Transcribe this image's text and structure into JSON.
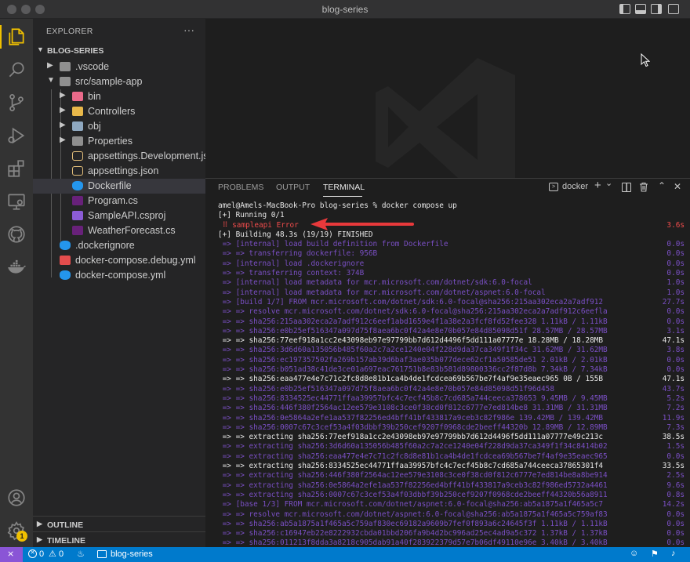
{
  "window": {
    "title": "blog-series"
  },
  "explorer": {
    "header": "EXPLORER",
    "more": "···",
    "folder": "BLOG-SERIES",
    "tree": [
      {
        "name": ".vscode",
        "type": "folder"
      },
      {
        "name": "src/sample-app",
        "type": "folder"
      },
      {
        "name": "bin",
        "type": "folder"
      },
      {
        "name": "Controllers",
        "type": "folder"
      },
      {
        "name": "obj",
        "type": "folder"
      },
      {
        "name": "Properties",
        "type": "folder"
      },
      {
        "name": "appsettings.Development.json",
        "type": "json"
      },
      {
        "name": "appsettings.json",
        "type": "json"
      },
      {
        "name": "Dockerfile",
        "type": "docker"
      },
      {
        "name": "Program.cs",
        "type": "csharp"
      },
      {
        "name": "SampleAPI.csproj",
        "type": "csproj"
      },
      {
        "name": "WeatherForecast.cs",
        "type": "csharp"
      },
      {
        "name": ".dockerignore",
        "type": "docker"
      },
      {
        "name": "docker-compose.debug.yml",
        "type": "yml"
      },
      {
        "name": "docker-compose.yml",
        "type": "docker"
      }
    ],
    "outline": "OUTLINE",
    "timeline": "TIMELINE"
  },
  "activity_icons": [
    "files-icon",
    "search-icon",
    "source-control-icon",
    "run-debug-icon",
    "extensions-icon",
    "remote-explorer-icon",
    "github-icon",
    "docker-icon",
    "account-icon",
    "settings-gear-icon"
  ],
  "account_badge": "1",
  "panel": {
    "tabs": {
      "problems": "PROBLEMS",
      "output": "OUTPUT",
      "terminal": "TERMINAL"
    },
    "terminal_name": "docker",
    "add": "+",
    "dropdown": "⌄",
    "lines": [
      {
        "t": "amel@Amels-MacBook-Pro blog-series % docker compose up",
        "tm": "",
        "c": "#e8e8e8"
      },
      {
        "t": "[+] Running 0/1",
        "tm": "",
        "c": "#e8e8e8"
      },
      {
        "t": " ⠿ sampleapi Error",
        "tm": "3.6s",
        "c": "#f14c4c"
      },
      {
        "t": "[+] Building 48.3s (19/19) FINISHED",
        "tm": "",
        "c": "#e8e8e8"
      },
      {
        "t": " => [internal] load build definition from Dockerfile",
        "tm": "0.0s",
        "c": "#7a4fc4"
      },
      {
        "t": " => => transferring dockerfile: 956B",
        "tm": "0.0s",
        "c": "#7a4fc4"
      },
      {
        "t": " => [internal] load .dockerignore",
        "tm": "0.0s",
        "c": "#7a4fc4"
      },
      {
        "t": " => => transferring context: 374B",
        "tm": "0.0s",
        "c": "#7a4fc4"
      },
      {
        "t": " => [internal] load metadata for mcr.microsoft.com/dotnet/sdk:6.0-focal",
        "tm": "1.0s",
        "c": "#7a4fc4"
      },
      {
        "t": " => [internal] load metadata for mcr.microsoft.com/dotnet/aspnet:6.0-focal",
        "tm": "1.0s",
        "c": "#7a4fc4"
      },
      {
        "t": " => [build 1/7] FROM mcr.microsoft.com/dotnet/sdk:6.0-focal@sha256:215aa302eca2a7adf912",
        "tm": "27.7s",
        "c": "#7a4fc4"
      },
      {
        "t": " => => resolve mcr.microsoft.com/dotnet/sdk:6.0-focal@sha256:215aa302eca2a7adf912c6eefla",
        "tm": "0.0s",
        "c": "#7a4fc4"
      },
      {
        "t": " => => sha256:215aa302eca2a7adf912c6eef1abd1659e4f1a38e2a3fcf8fd52fee328 1.11kB / 1.11kB",
        "tm": "0.0s",
        "c": "#7a4fc4"
      },
      {
        "t": " => => sha256:e0b25ef516347a097d75f8aea6bc0f42a4e8e70b057e84d85098d51f 28.57MB / 28.57MB",
        "tm": "3.1s",
        "c": "#7a4fc4"
      },
      {
        "t": " => => sha256:77eef918a1cc2e43098eb97e97799bb7d612d4496f5dd111a07777e 18.28MB / 18.28MB",
        "tm": "47.1s",
        "c": "#e8e8e8"
      },
      {
        "t": " => => sha256:3d6d60a135056b485f60a2c7a2ce1240e04f228d9da37ca349f1f34c 31.62MB / 31.62MB",
        "tm": "3.8s",
        "c": "#7a4fc4"
      },
      {
        "t": " => => sha256:ec197357502fa269b157ab39d6baf3ae035b077dece62cf1a50585de51 2.01kB / 2.01kB",
        "tm": "0.0s",
        "c": "#7a4fc4"
      },
      {
        "t": " => => sha256:b051ad38c41de3ce01a697eac761751b8e83b581d89800336cc2f87d8b 7.34kB / 7.34kB",
        "tm": "0.0s",
        "c": "#7a4fc4"
      },
      {
        "t": " => => sha256:eaa477e4e7c71c2fc8d8e81b1ca4b4de1fcdcea69b567be7f4af9e35eaec965 0B / 155B",
        "tm": "47.1s",
        "c": "#e8e8e8"
      },
      {
        "t": " => => sha256:e0b25ef516347a097d75f8aea6bc0f42a4e8e70b057e84d85098d51f96d458",
        "tm": "43.7s",
        "c": "#7a4fc4"
      },
      {
        "t": " => => sha256:8334525ec44771ffaa39957bfc4c7ecf45b8c7cd685a744ceeca378653 9.45MB / 9.45MB",
        "tm": "5.2s",
        "c": "#7a4fc4"
      },
      {
        "t": " => => sha256:446f380f2564ac12ee579e3108c3ce0f38cd0f812c6777e7ed814be8 31.31MB / 31.31MB",
        "tm": "7.2s",
        "c": "#7a4fc4"
      },
      {
        "t": " => => sha256:0e5864a2efe1aa537f82256ed4bff41bf433817a9ceb3c82f986e 139.42MB / 139.42MB",
        "tm": "11.9s",
        "c": "#7a4fc4"
      },
      {
        "t": " => => sha256:0007c67c3cef53a4f03dbbf39b250cef9207f0968cde2beeff44320b 12.89MB / 12.89MB",
        "tm": "7.3s",
        "c": "#7a4fc4"
      },
      {
        "t": " => => extracting sha256:77eef918a1cc2e43098eb97e97799bb7d612d4496f5dd111a07777e49c213c",
        "tm": "38.5s",
        "c": "#e8e8e8"
      },
      {
        "t": " => => extracting sha256:3d6d60a135056b485f60a2c7a2ce1240e04f228d9da37ca349f1f34c8414b02",
        "tm": "1.5s",
        "c": "#7a4fc4"
      },
      {
        "t": " => => extracting sha256:eaa477e4e7c71c2fc8d8e81b1ca4b4de1fcdcea69b567be7f4af9e35eaec965",
        "tm": "0.0s",
        "c": "#7a4fc4"
      },
      {
        "t": " => => extracting sha256:8334525ec44771ffaa39957bfc4c7ecf45b8c7cd685a744ceeca37865301f4",
        "tm": "33.5s",
        "c": "#e8e8e8"
      },
      {
        "t": " => => extracting sha256:446f380f2564ac12ee579e3108c3ce0f38cd0f812c6777e7ed814be8a8be914",
        "tm": "2.5s",
        "c": "#7a4fc4"
      },
      {
        "t": " => => extracting sha256:0e5864a2efe1aa537f82256ed4bff41bf433817a9ceb3c82f986ed5732a4461",
        "tm": "9.6s",
        "c": "#7a4fc4"
      },
      {
        "t": " => => extracting sha256:0007c67c3cef53a4f03dbbf39b250cef9207f0968cde2beeff44320b56a8911",
        "tm": "0.8s",
        "c": "#7a4fc4"
      },
      {
        "t": " => [base 1/3] FROM mcr.microsoft.com/dotnet/aspnet:6.0-focal@sha256:ab5a1875a1f465a5c7",
        "tm": "14.2s",
        "c": "#7a4fc4"
      },
      {
        "t": " => => resolve mcr.microsoft.com/dotnet/aspnet:6.0-focal@sha256:ab5a1875a1f465a5c759af83",
        "tm": "0.0s",
        "c": "#7a4fc4"
      },
      {
        "t": " => => sha256:ab5a1875a1f465a5c759af830ec69182a9609b7fef0f893a6c24645f3f 1.11kB / 1.11kB",
        "tm": "0.0s",
        "c": "#7a4fc4"
      },
      {
        "t": " => => sha256:c16947eb22e8222932cbda01bbd206fa9b4d2bc996ad25ec4ad9a5c372 1.37kB / 1.37kB",
        "tm": "0.0s",
        "c": "#7a4fc4"
      },
      {
        "t": " => => sha256:011213f8dda3a8218c905dab91a40f283922379d57e7b06df49110e96e 3.40kB / 3.40kB",
        "tm": "0.0s",
        "c": "#7a4fc4"
      }
    ]
  },
  "statusbar": {
    "errors": "0",
    "warnings": "0",
    "folder": "blog-series"
  }
}
